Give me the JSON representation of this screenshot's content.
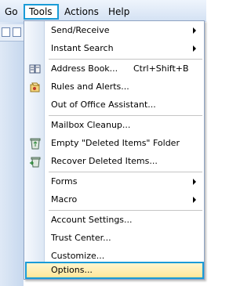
{
  "menubar": {
    "items": [
      "Go",
      "Tools",
      "Actions",
      "Help"
    ]
  },
  "tools_menu": {
    "groups": [
      [
        {
          "label": "Send/Receive",
          "submenu": true
        },
        {
          "label": "Instant Search",
          "submenu": true
        }
      ],
      [
        {
          "label": "Address Book...",
          "shortcut": "Ctrl+Shift+B",
          "icon": "address-book-icon"
        },
        {
          "label": "Rules and Alerts...",
          "icon": "rules-icon"
        },
        {
          "label": "Out of Office Assistant..."
        }
      ],
      [
        {
          "label": "Mailbox Cleanup..."
        },
        {
          "label": "Empty \"Deleted Items\" Folder",
          "icon": "recycle-bin-icon"
        },
        {
          "label": "Recover Deleted Items...",
          "icon": "recover-icon"
        }
      ],
      [
        {
          "label": "Forms",
          "submenu": true
        },
        {
          "label": "Macro",
          "submenu": true
        }
      ],
      [
        {
          "label": "Account Settings..."
        },
        {
          "label": "Trust Center..."
        },
        {
          "label": "Customize..."
        }
      ],
      [
        {
          "label": "Options...",
          "highlighted": true
        }
      ]
    ]
  },
  "colors": {
    "highlight_border": "#1a9bd7",
    "highlight_fill": "#ffe79a",
    "menubar": "#d3e1f3"
  }
}
